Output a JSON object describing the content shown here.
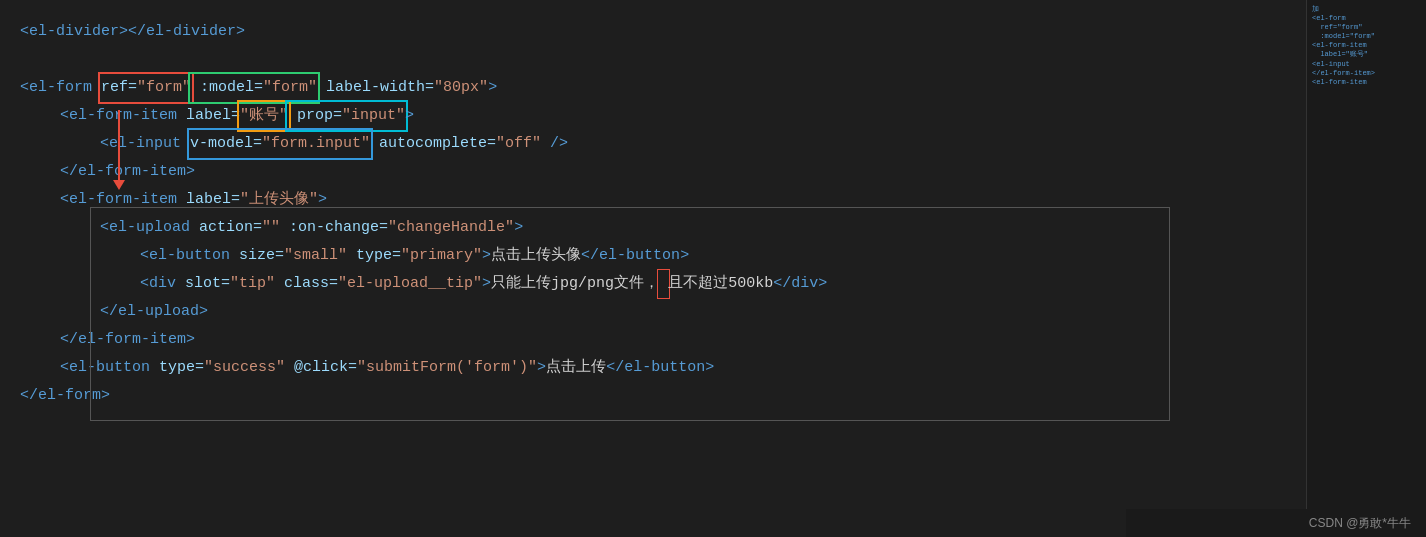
{
  "code": {
    "line1": "<el-divider></el-divider>",
    "line2": "",
    "line3_start": "<el-form ",
    "line3_ref": "ref=\"form\"",
    "line3_model": " :model=\"form\"",
    "line3_rest": " label-width=\"80px\">",
    "line4_start": "    <el-form-item label=",
    "line4_label": "\"账号\"",
    "line4_prop": " prop=\"input\"",
    "line4_end": ">",
    "line5_start": "        <el-input ",
    "line5_vmodel": "v-model=\"form.input\"",
    "line5_rest": " autocomplete=\"off\" />",
    "line6": "    </el-form-item>",
    "line7_start": "    <el-form-item label=",
    "line7_label": "\"上传头像\"",
    "line7_end": ">",
    "line8_start": "        <el-upload action=\"\" :on-change=",
    "line8_handler": "\"changeHandle\"",
    "line8_end": ">",
    "line9_start": "            <el-button size=",
    "line9_size": "\"small\"",
    "line9_type": " type=\"primary\"",
    "line9_text": ">点击上传头像</el-button>",
    "line10_start": "            <div slot=",
    "line10_slot": "\"tip\"",
    "line10_class": " class=\"el-upload__tip\"",
    "line10_text": ">只能上传jpg/png文件，",
    "line10_rest": "且不超过500kb</div>",
    "line11": "        </el-upload>",
    "line12": "    </el-form-item>",
    "line13_start": "    <el-button type=",
    "line13_type": "\"success\"",
    "line13_click": " @click=\"submitForm('form')\"",
    "line13_text": ">点击上传</el-button>",
    "line14": "</el-form>",
    "watermark": "CSDN @勇敢*牛牛"
  }
}
